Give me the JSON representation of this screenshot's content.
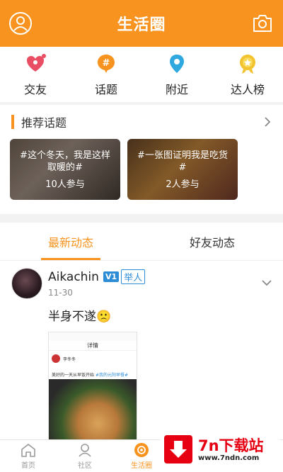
{
  "header": {
    "title": "生活圈"
  },
  "quicknav": [
    {
      "label": "交友",
      "icon": "heart-icon",
      "color": "#e94e64"
    },
    {
      "label": "话题",
      "icon": "hashtag-icon",
      "color": "#f7931e"
    },
    {
      "label": "附近",
      "icon": "location-pin-icon",
      "color": "#2fa8e0"
    },
    {
      "label": "达人榜",
      "icon": "medal-icon",
      "color": "#f2c32e"
    }
  ],
  "recommended": {
    "title": "推荐话题",
    "cards": [
      {
        "topic": "#这个冬天，我是这样取暖的#",
        "participants": "10人参与"
      },
      {
        "topic": "#一张图证明我是吃货#",
        "participants": "2人参与"
      }
    ]
  },
  "tabs": [
    {
      "label": "最新动态",
      "active": true
    },
    {
      "label": "好友动态",
      "active": false
    }
  ],
  "post": {
    "author": "Aikachin",
    "badge_v": "V1",
    "badge_label": "举人",
    "time": "11-30",
    "text": "半身不遂🙁",
    "image": {
      "nav_title": "详情",
      "user": "李冬冬",
      "caption": "美好的一天从早饭开始",
      "tag": "#我的元阳早餐#"
    }
  },
  "bottom_nav": [
    {
      "label": "首页",
      "icon": "home-icon",
      "active": false
    },
    {
      "label": "社区",
      "icon": "community-icon",
      "active": false
    },
    {
      "label": "生活圈",
      "icon": "life-circle-icon",
      "active": true
    }
  ],
  "watermark": {
    "main": "7n下载站",
    "url": "www.7ndn.com"
  },
  "colors": {
    "accent": "#f7931e",
    "vip": "#2d8cd6"
  }
}
